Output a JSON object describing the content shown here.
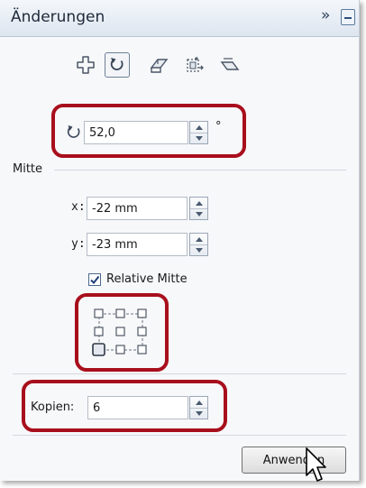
{
  "panel": {
    "title": "Änderungen",
    "collapse_glyph": "»"
  },
  "toolbar": {
    "tools": [
      {
        "name": "position-tool",
        "icon": "move-cross-icon"
      },
      {
        "name": "rotate-tool",
        "icon": "rotate-icon",
        "active": true
      },
      {
        "name": "mirror-tool",
        "icon": "mirror-icon"
      },
      {
        "name": "size-tool",
        "icon": "size-icon"
      },
      {
        "name": "skew-tool",
        "icon": "skew-icon"
      }
    ]
  },
  "rotation": {
    "value": "52,0",
    "unit": "°"
  },
  "center": {
    "section_label": "Mitte",
    "x_label": "x:",
    "x_value": "-22 mm",
    "y_label": "y:",
    "y_value": "-23 mm",
    "relative_label": "Relative Mitte",
    "relative_checked": true,
    "anchor_selected": "bottom-left"
  },
  "copies": {
    "label": "Kopien:",
    "value": "6"
  },
  "apply_button": "Anwenden",
  "colors": {
    "highlight": "#a80f1c",
    "title_text": "#1e2a3a",
    "accent_blue": "#4d6b8d"
  }
}
